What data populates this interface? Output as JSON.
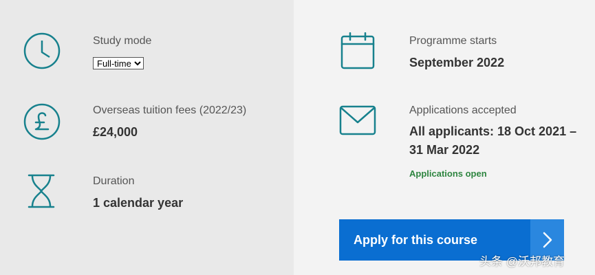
{
  "colors": {
    "icon_teal": "#17818d",
    "accent_blue": "#0a6ed1",
    "status_green": "#2e8540"
  },
  "study_mode": {
    "icon": "clock-icon",
    "label": "Study mode",
    "selected": "Full-time"
  },
  "fees": {
    "icon": "pound-icon",
    "label": "Overseas tuition fees (2022/23)",
    "value": "£24,000"
  },
  "duration": {
    "icon": "hourglass-icon",
    "label": "Duration",
    "value": "1 calendar year"
  },
  "programme_start": {
    "icon": "calendar-icon",
    "label": "Programme starts",
    "value": "September 2022"
  },
  "applications": {
    "icon": "envelope-icon",
    "label": "Applications accepted",
    "value": "All applicants: 18 Oct 2021 – 31 Mar 2022",
    "status": "Applications open"
  },
  "apply_button": {
    "label": "Apply for this course",
    "icon": "chevron-right-icon"
  },
  "watermark": "头条 @沃邦教育"
}
